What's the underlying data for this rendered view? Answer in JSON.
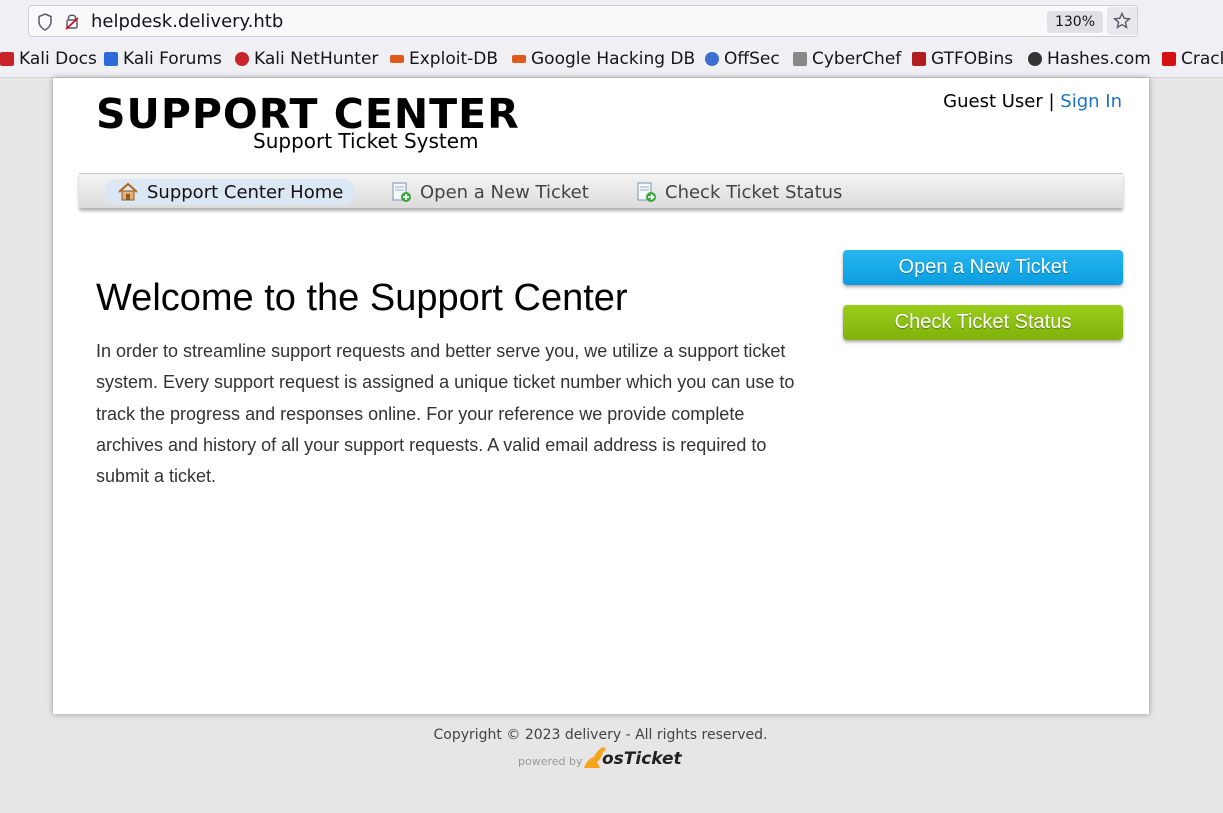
{
  "browser": {
    "url": "helpdesk.delivery.htb",
    "zoom": "130%",
    "bookmarks": [
      {
        "label": "Kali Docs",
        "color": "#c8232a"
      },
      {
        "label": "Kali Forums",
        "color": "#2f6bd8"
      },
      {
        "label": "Kali NetHunter",
        "color": "#c8232a"
      },
      {
        "label": "Exploit-DB",
        "color": "#e05a1c"
      },
      {
        "label": "Google Hacking DB",
        "color": "#e05a1c"
      },
      {
        "label": "OffSec",
        "color": "#3d6fd0"
      },
      {
        "label": "CyberChef",
        "color": "#888888"
      },
      {
        "label": "GTFOBins",
        "color": "#b01e1e"
      },
      {
        "label": "Hashes.com",
        "color": "#333333"
      },
      {
        "label": "Crack",
        "color": "#d41010"
      }
    ]
  },
  "header": {
    "logo_title": "SUPPORT CENTER",
    "logo_subtitle": "Support Ticket System",
    "guest_label": "Guest User |",
    "sign_in": "Sign In"
  },
  "nav": {
    "items": [
      {
        "label": "Support Center Home",
        "icon": "home-icon"
      },
      {
        "label": "Open a New Ticket",
        "icon": "new-ticket-icon"
      },
      {
        "label": "Check Ticket Status",
        "icon": "ticket-status-icon"
      }
    ]
  },
  "main": {
    "title": "Welcome to the Support Center",
    "body": "In order to streamline support requests and better serve you, we utilize a support ticket system. Every support request is assigned a unique ticket number which you can use to track the progress and responses online. For your reference we provide complete archives and history of all your support requests. A valid email address is required to submit a ticket."
  },
  "sidebar": {
    "open_ticket": "Open a New Ticket",
    "check_status": "Check Ticket Status"
  },
  "footer": {
    "copyright": "Copyright © 2023 delivery - All rights reserved.",
    "powered_by": "powered by",
    "brand": "osTicket"
  },
  "colors": {
    "link": "#1a73c9",
    "btn_blue": "#0a9de0",
    "btn_green": "#7fb30c"
  }
}
